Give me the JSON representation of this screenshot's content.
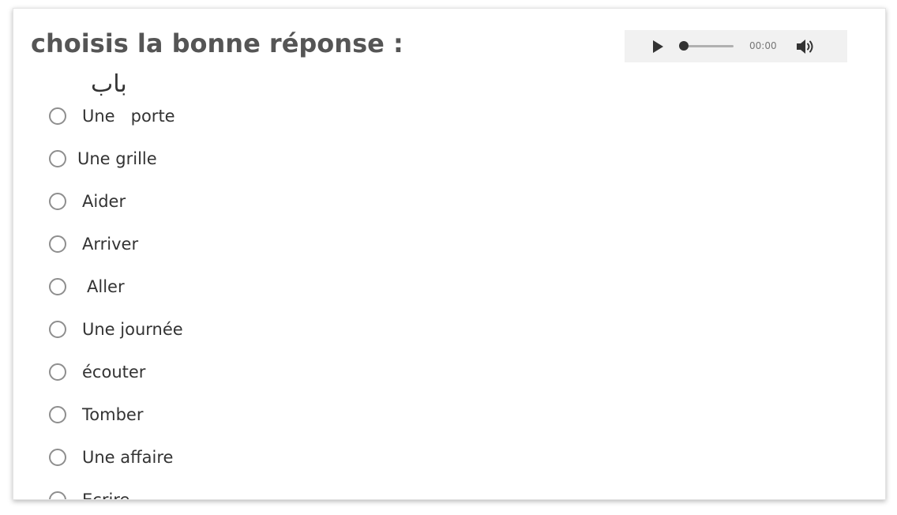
{
  "question": {
    "title": "choisis la bonne réponse :",
    "arabic_word": "باب"
  },
  "audio_player": {
    "time": "00:00",
    "play_icon": "play-icon",
    "volume_icon": "volume-icon",
    "progress": 0
  },
  "options": [
    {
      "label": "Une   porte"
    },
    {
      "label": "Une grille"
    },
    {
      "label": "Aider"
    },
    {
      "label": "Arriver"
    },
    {
      "label": "Aller"
    },
    {
      "label": "Une journée"
    },
    {
      "label": "écouter"
    },
    {
      "label": "Tomber"
    },
    {
      "label": "Une affaire"
    },
    {
      "label": "Ecrire"
    }
  ],
  "colors": {
    "title": "#555555",
    "text": "#333333",
    "radio_border": "#8e8e8e",
    "player_bg": "#f1f1f1"
  }
}
